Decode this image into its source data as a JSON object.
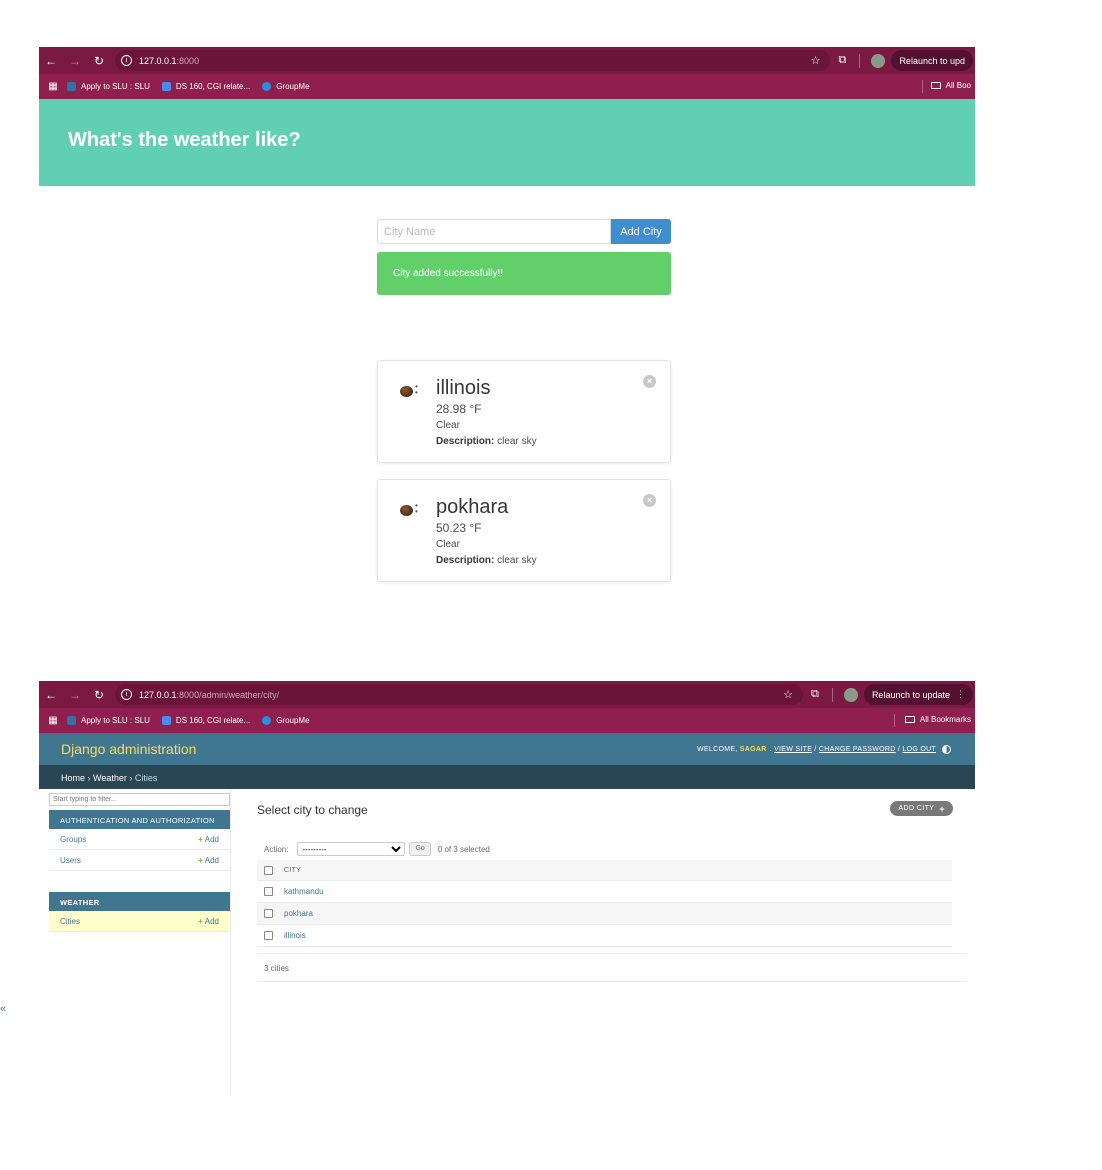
{
  "browser": {
    "bookmarks": [
      {
        "label": "Apply to SLU : SLU",
        "color": "#3a6ea5"
      },
      {
        "label": "DS 160, CGI relate...",
        "color": "#4a8af4"
      },
      {
        "label": "GroupMe",
        "color": "#2d8ce3"
      }
    ],
    "all_bookmarks": "All Bookmarks",
    "relaunch_short": "Relaunch to upd",
    "relaunch": "Relaunch to update"
  },
  "weather_window": {
    "url_host": "127.0.0.1",
    "url_path": ":8000",
    "relaunch_label": "Relaunch to upd",
    "all_bookmarks": "All Boo",
    "title": "What's the weather like?",
    "input_placeholder": "City Name",
    "add_button": "Add City",
    "flash": "City added successfully!!",
    "cards": [
      {
        "city": "illinois",
        "temp": "28.98 °F",
        "main": "Clear",
        "desc_label": "Description:",
        "desc": "clear sky"
      },
      {
        "city": "pokhara",
        "temp": "50.23 °F",
        "main": "Clear",
        "desc_label": "Description:",
        "desc": "clear sky"
      }
    ]
  },
  "admin_window": {
    "url_host": "127.0.0.1",
    "url_path": ":8000/admin/weather/city/",
    "brand": "Django administration",
    "welcome": "Welcome,",
    "username": "sagar",
    "view_site": "View site",
    "change_password": "Change password",
    "log_out": "Log out",
    "breadcrumb": {
      "home": "Home",
      "app": "Weather",
      "current": "Cities"
    },
    "filter_placeholder": "Start typing to filter...",
    "sidebar": {
      "auth_caption": "Authentication and Authorization",
      "auth_items": [
        {
          "label": "Groups",
          "add": "Add"
        },
        {
          "label": "Users",
          "add": "Add"
        }
      ],
      "weather_caption": "Weather",
      "weather_items": [
        {
          "label": "Cities",
          "add": "Add"
        }
      ]
    },
    "page_title": "Select city to change",
    "add_city": "ADD CITY",
    "action_label": "Action:",
    "action_value": "---------",
    "go": "Go",
    "selected": "0 of 3 selected",
    "column": "CITY",
    "rows": [
      "kathmandu",
      "pokhara",
      "illinois"
    ],
    "count": "3 cities"
  }
}
